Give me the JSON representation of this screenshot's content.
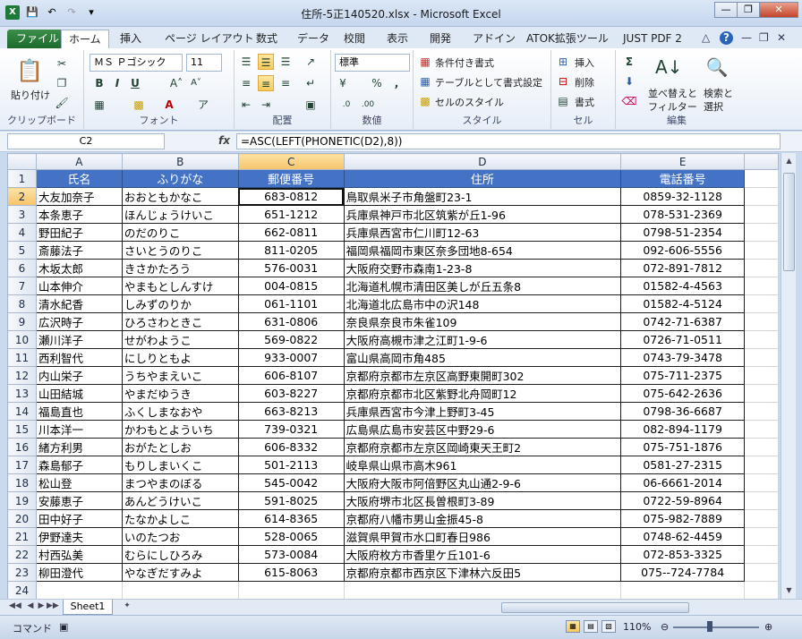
{
  "window": {
    "title": "住所-5正140520.xlsx  -  Microsoft Excel"
  },
  "tabs": [
    "ファイル",
    "ホーム",
    "挿入",
    "ページ レイアウト",
    "数式",
    "データ",
    "校閲",
    "表示",
    "開発",
    "アドイン",
    "ATOK拡張ツール",
    "JUST PDF 2"
  ],
  "ribbon": {
    "clipboard": {
      "paste": "貼り付け",
      "label": "クリップボード"
    },
    "font": {
      "name": "ＭＳ Ｐゴシック",
      "size": "11",
      "label": "フォント"
    },
    "alignment": {
      "label": "配置"
    },
    "number": {
      "format": "標準",
      "label": "数値"
    },
    "styles": {
      "conditional": "条件付き書式",
      "table": "テーブルとして書式設定",
      "cell_styles": "セルのスタイル",
      "label": "スタイル"
    },
    "cells": {
      "insert": "挿入",
      "delete": "削除",
      "format": "書式",
      "label": "セル"
    },
    "editing": {
      "sort": "並べ替えと",
      "filter": "フィルター",
      "find": "検索と",
      "select": "選択",
      "label": "編集"
    }
  },
  "formula_bar": {
    "name_box": "C2",
    "fx": "fx",
    "formula": "=ASC(LEFT(PHONETIC(D2),8))"
  },
  "sheet": {
    "columns": [
      "A",
      "B",
      "C",
      "D",
      "E"
    ],
    "headers": [
      "氏名",
      "ふりがな",
      "郵便番号",
      "住所",
      "電話番号"
    ],
    "rows": [
      [
        "大友加奈子",
        "おおともかなこ",
        "683-0812",
        "鳥取県米子市角盤町23-1",
        "0859-32-1128"
      ],
      [
        "本条恵子",
        "ほんじょうけいこ",
        "651-1212",
        "兵庫県神戸市北区筑紫が丘1-96",
        "078-531-2369"
      ],
      [
        "野田紀子",
        "のだのりこ",
        "662-0811",
        "兵庫県西宮市仁川町12-63",
        "0798-51-2354"
      ],
      [
        "斎藤法子",
        "さいとうのりこ",
        "811-0205",
        "福岡県福岡市東区奈多団地8-654",
        "092-606-5556"
      ],
      [
        "木坂太郎",
        "きさかたろう",
        "576-0031",
        "大阪府交野市森南1-23-8",
        "072-891-7812"
      ],
      [
        "山本伸介",
        "やまもとしんすけ",
        "004-0815",
        "北海道札幌市清田区美しが丘五条8",
        "01582-4-4563"
      ],
      [
        "清水紀香",
        "しみずのりか",
        "061-1101",
        "北海道北広島市中の沢148",
        "01582-4-5124"
      ],
      [
        "広沢時子",
        "ひろさわときこ",
        "631-0806",
        "奈良県奈良市朱雀109",
        "0742-71-6387"
      ],
      [
        "瀬川洋子",
        "せがわようこ",
        "569-0822",
        "大阪府高槻市津之江町1-9-6",
        "0726-71-0511"
      ],
      [
        "西利智代",
        "にしりともよ",
        "933-0007",
        "富山県高岡市角485",
        "0743-79-3478"
      ],
      [
        "内山栄子",
        "うちやまえいこ",
        "606-8107",
        "京都府京都市左京区高野東開町302",
        "075-711-2375"
      ],
      [
        "山田結城",
        "やまだゆうき",
        "603-8227",
        "京都府京都市北区紫野北舟岡町12",
        "075-642-2636"
      ],
      [
        "福島直也",
        "ふくしまなおや",
        "663-8213",
        "兵庫県西宮市今津上野町3-45",
        "0798-36-6687"
      ],
      [
        "川本洋一",
        "かわもとよういち",
        "739-0321",
        "広島県広島市安芸区中野29-6",
        "082-894-1179"
      ],
      [
        "緒方利男",
        "おがたとしお",
        "606-8332",
        "京都府京都市左京区岡崎東天王町2",
        "075-751-1876"
      ],
      [
        "森島郁子",
        "もりしまいくこ",
        "501-2113",
        "岐阜県山県市高木961",
        "0581-27-2315"
      ],
      [
        "松山登",
        "まつやまのぼる",
        "545-0042",
        "大阪府大阪市阿倍野区丸山通2-9-6",
        "06-6661-2014"
      ],
      [
        "安藤恵子",
        "あんどうけいこ",
        "591-8025",
        "大阪府堺市北区長曽根町3-89",
        "0722-59-8964"
      ],
      [
        "田中好子",
        "たなかよしこ",
        "614-8365",
        "京都府八幡市男山金振45-8",
        "075-982-7889"
      ],
      [
        "伊野達夫",
        "いのたつお",
        "528-0065",
        "滋賀県甲賀市水口町春日986",
        "0748-62-4459"
      ],
      [
        "村西弘美",
        "むらにしひろみ",
        "573-0084",
        "大阪府枚方市香里ケ丘101-6",
        "072-853-3325"
      ],
      [
        "柳田澄代",
        "やなぎだすみよ",
        "615-8063",
        "京都府京都市西京区下津林六反田5",
        "075--724-7784"
      ]
    ],
    "selected_cell": "C2",
    "tab_name": "Sheet1"
  },
  "status": {
    "mode": "コマンド",
    "zoom": "110%"
  },
  "colors": {
    "header_fill": "#4472C4",
    "header_text": "#FFFFFF",
    "file_tab": "#1C6A2C"
  }
}
